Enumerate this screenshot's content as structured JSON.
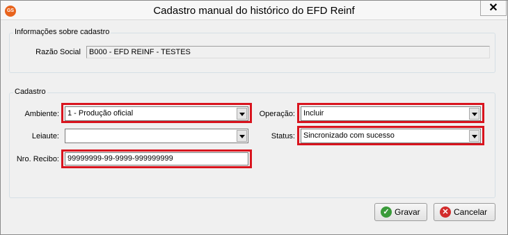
{
  "window": {
    "title": "Cadastro manual do histórico do EFD Reinf",
    "app_icon_text": "GS",
    "close_glyph": "✕"
  },
  "info_group": {
    "legend": "Informações sobre cadastro",
    "razao_social_label": "Razão Social",
    "razao_social_value": "B000 - EFD REINF - TESTES"
  },
  "cadastro_group": {
    "legend": "Cadastro",
    "ambiente_label": "Ambiente:",
    "ambiente_value": "1 - Produção oficial",
    "leiaute_label": "Leiaute:",
    "leiaute_value": "",
    "nro_recibo_label": "Nro. Recibo:",
    "nro_recibo_value": "99999999-99-9999-999999999",
    "operacao_label": "Operação:",
    "operacao_value": "Incluir",
    "status_label": "Status:",
    "status_value": "Sincronizado com sucesso"
  },
  "buttons": {
    "gravar_label": "Gravar",
    "cancelar_label": "Cancelar"
  },
  "colors": {
    "highlight": "#d9141e",
    "gravar_icon": "#3a9b3a",
    "cancelar_icon": "#d22c2c"
  }
}
